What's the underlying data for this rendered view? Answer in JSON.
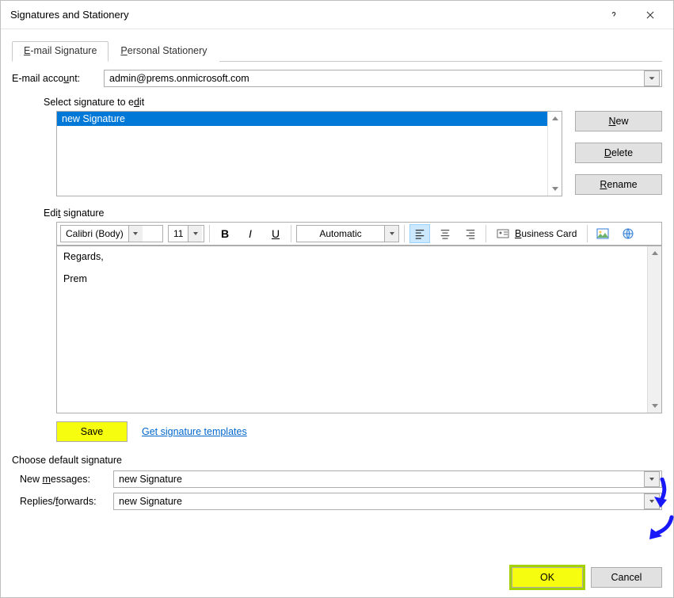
{
  "title": "Signatures and Stationery",
  "tabs": {
    "email_sig": "E-mail Signature",
    "stationery": "Personal Stationery"
  },
  "account": {
    "label": "E-mail account:",
    "value": "admin@prems.onmicrosoft.com"
  },
  "select_sig": {
    "label": "Select signature to edit",
    "items": [
      "new Signature"
    ],
    "buttons": {
      "new": "New",
      "delete": "Delete",
      "rename": "Rename"
    }
  },
  "edit_sig": {
    "label": "Edit signature",
    "font": "Calibri (Body)",
    "size": "11",
    "color_label": "Automatic",
    "business_card": "Business Card",
    "content_line1": "Regards,",
    "content_line2": "Prem"
  },
  "save_label": "Save",
  "templates_link": "Get signature templates",
  "defaults": {
    "label": "Choose default signature",
    "new_msgs": {
      "label": "New messages:",
      "value": "new Signature"
    },
    "replies": {
      "label": "Replies/forwards:",
      "value": "new Signature"
    }
  },
  "footer": {
    "ok": "OK",
    "cancel": "Cancel"
  }
}
